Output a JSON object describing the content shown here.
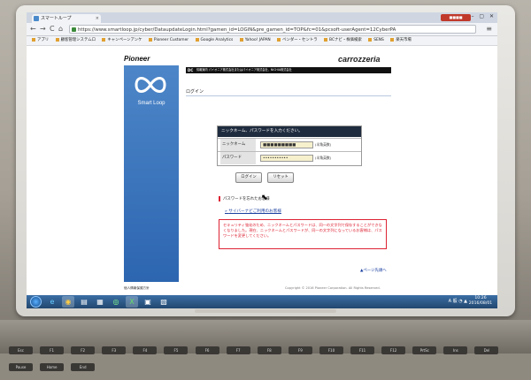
{
  "browser": {
    "tab_title": "スマートループ",
    "tab_close": "×",
    "user_badge": "■■■■",
    "window_controls": "– ▢ ✕",
    "url": "https://www.smartloop.jp/cyber/DataupdateLogin.html?gamen_id=LOGIN&pre_gamen_id=TOP&fc=01&pcsoft-userAgent=12CyberPA",
    "nav_back": "←",
    "nav_forward": "→",
    "nav_reload": "C",
    "nav_home": "⌂",
    "bookmarks": [
      "アプリ",
      "顧客管理システムロ",
      "キャンペーンアンケ",
      "Pioneer Customer",
      "Google Analytics",
      "Yahoo! JAPAN",
      "ベンダー・セントラ",
      "BCナビ・株価検索",
      "SENS",
      "楽天市場"
    ]
  },
  "page": {
    "pioneer_logo": "Pioneer",
    "carrozzeria_logo": "carrozzeria",
    "header_bar_code": "DC",
    "header_bar_text": "情報案内 パイオニア株式会社またはパイオニア株式会社、NICHIA株式会社",
    "sidebar_brand": "Smart Loop",
    "sidebar_footer": "個人情報保護方針",
    "login_title": "ログイン",
    "form": {
      "heading": "ニックネーム、パスワードを入力ください。",
      "nickname_label": "ニックネーム",
      "nickname_value": "■■■■■■■■■",
      "nickname_note": "(半角英数)",
      "password_label": "パスワード",
      "password_value": "•••••••••••",
      "password_note": "(半角英数)"
    },
    "login_button": "ログイン",
    "reset_button": "リセット",
    "forgot_title": "パスワードを忘れたお客様",
    "support_link": "サイバーナビご利用のお客様",
    "notice": "セキュリティ強化のため、ニックネームとパスワードは、同一の文字列で保存することができなくなりました。現在、ニックネームとパスワードが、同一の文字列になっているお客様は、パスワードを変更してください。",
    "page_top": "▲ページ先頭へ",
    "copyright": "Copyright © 2016 Pioneer Corporation. All Rights Reserved."
  },
  "taskbar": {
    "apps": [
      "e",
      "◉",
      "▤",
      "▦",
      "◎",
      "X",
      "▣",
      "▧"
    ],
    "tray_text": "A 般 ◔ ▲",
    "time": "10:26",
    "date": "2016/08/01"
  },
  "keyboard": {
    "keys": [
      "Esc",
      "F1",
      "F2",
      "F3",
      "F4",
      "F5",
      "F6",
      "F7",
      "F8",
      "F9",
      "F10",
      "F11",
      "F12",
      "PrtSc",
      "Ins",
      "Del",
      "Pause",
      "Home",
      "End"
    ]
  },
  "colors": {
    "sidebar_blue": "#3a74bd",
    "form_header": "#1f2c3f",
    "notice_red": "#dd2233",
    "link_blue": "#1a3fa0"
  }
}
